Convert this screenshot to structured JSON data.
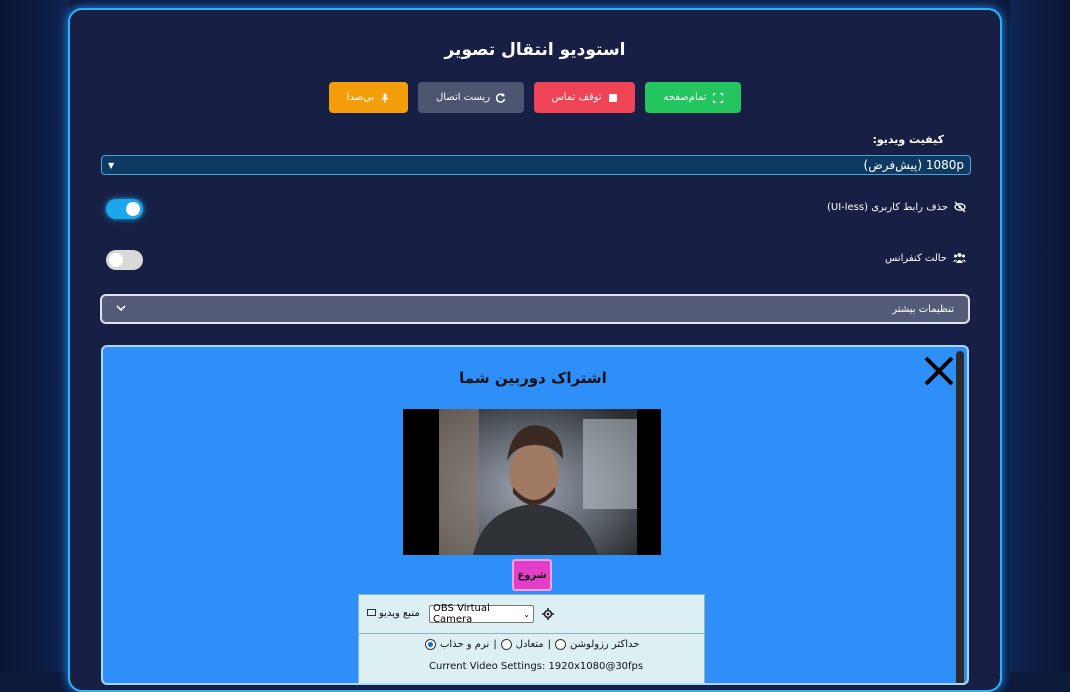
{
  "panel": {
    "title": "استودیو انتقال تصویر"
  },
  "toolbar": {
    "fullscreen": "تمام‌صفحه",
    "stop_call": "توقف تماس",
    "reset_connection": "ریست اتصال",
    "mute": "بی‌صدا"
  },
  "video_quality": {
    "label": "کیفیت ویدیو:",
    "selected": "1080p (پیش‌فرض)"
  },
  "options": {
    "ui_less": {
      "label": "حذف رابط کاربری (UI-less)",
      "on": true
    },
    "conference": {
      "label": "حالت کنفرانس",
      "on": false
    }
  },
  "more_settings": {
    "label": "تنظیمات بیشتر"
  },
  "share": {
    "title": "اشتراک دوربین شما",
    "start_label": "شروع",
    "video_source_label": "منبع ویدیو",
    "video_source_selected": "OBS Virtual Camera",
    "radio_options": [
      "حداکثر رزولوشن",
      "متعادل",
      "نرم و حذاب"
    ],
    "radio_selected": 2,
    "current_settings": "Current Video Settings: 1920x1080@30fps"
  },
  "colors": {
    "fullscreen_btn": "#22c55e",
    "stop_btn": "#ef4456",
    "reset_btn": "#4d5670",
    "mute_btn": "#f59e0b",
    "toggle_on": "#1aa7ec",
    "toggle_off": "#d9d9d9"
  }
}
